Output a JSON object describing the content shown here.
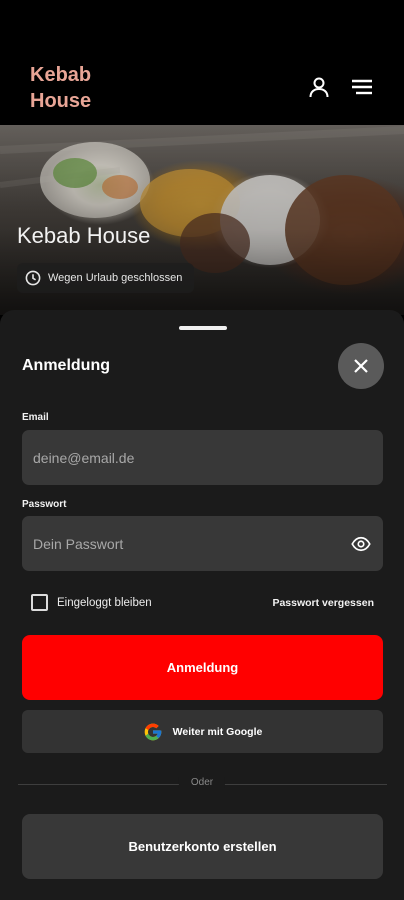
{
  "header": {
    "logo_line1": "Kebab",
    "logo_line2": "House",
    "user_icon": "user-icon",
    "menu_icon": "hamburger-menu-icon"
  },
  "hero": {
    "title": "Kebab House",
    "status_icon": "clock-icon",
    "status_text": "Wegen Urlaub geschlossen"
  },
  "login": {
    "title": "Anmeldung",
    "close_icon": "close-icon",
    "email_label": "Email",
    "email_placeholder": "deine@email.de",
    "password_label": "Passwort",
    "password_placeholder": "Dein Passwort",
    "show_password_icon": "eye-icon",
    "remember_label": "Eingeloggt bleiben",
    "forgot_label": "Passwort vergessen",
    "submit_label": "Anmeldung",
    "google_label": "Weiter mit Google",
    "divider_label": "Oder",
    "create_account_label": "Benutzerkonto erstellen"
  },
  "colors": {
    "accent": "#ff0000",
    "logo": "#e8a596",
    "sheet_bg": "#1b1b1b",
    "field_bg": "#383838"
  }
}
